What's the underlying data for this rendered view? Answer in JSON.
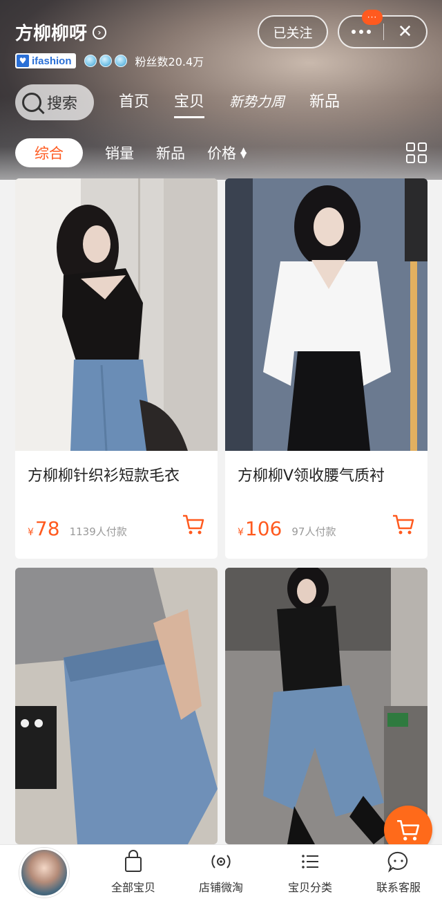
{
  "shop": {
    "name": "方柳柳呀",
    "badge": "ifashion",
    "fans": "粉丝数20.4万",
    "follow_label": "已关注",
    "notif_badge": "···"
  },
  "nav": {
    "search_label": "搜索",
    "tabs": [
      "首页",
      "宝贝",
      "新势力周",
      "新品"
    ],
    "active_tab": "宝贝"
  },
  "filters": {
    "items": [
      "综合",
      "销量",
      "新品",
      "价格"
    ],
    "active": "综合"
  },
  "products": [
    {
      "title": "方柳柳针织衫短款毛衣",
      "price": "78",
      "currency": "¥",
      "sold": "1139人付款"
    },
    {
      "title": "方柳柳V领收腰气质衬",
      "price": "106",
      "currency": "¥",
      "sold": "97人付款"
    },
    {
      "title": "",
      "price": "",
      "currency": "",
      "sold": ""
    },
    {
      "title": "",
      "price": "",
      "currency": "",
      "sold": ""
    }
  ],
  "tabbar": {
    "items": [
      "全部宝贝",
      "店铺微淘",
      "宝贝分类",
      "联系客服"
    ]
  },
  "colors": {
    "accent": "#ff5a1f",
    "background": "#f2f2f2"
  }
}
